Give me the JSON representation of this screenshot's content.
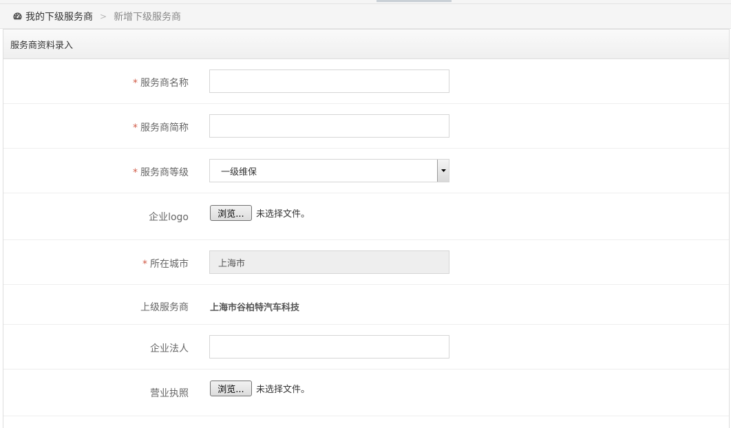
{
  "breadcrumb": {
    "home_icon": "dashboard-icon",
    "home_label": "我的下级服务商",
    "separator": ">",
    "current_label": "新增下级服务商"
  },
  "panel": {
    "title": "服务商资料录入"
  },
  "form": {
    "required_mark": "*",
    "provider_name": {
      "label": "服务商名称",
      "value": "",
      "placeholder": ""
    },
    "provider_short_name": {
      "label": "服务商简称",
      "value": "",
      "placeholder": ""
    },
    "provider_level": {
      "label": "服务商等级",
      "selected": "一级维保",
      "arrow_icon": "dropdown-arrow-icon"
    },
    "company_logo": {
      "label": "企业logo",
      "button_label": "浏览...",
      "status": "未选择文件。"
    },
    "city": {
      "label": "所在城市",
      "value": "上海市"
    },
    "parent_provider": {
      "label": "上级服务商",
      "value": "上海市谷柏特汽车科技"
    },
    "legal_person": {
      "label": "企业法人",
      "value": "",
      "placeholder": ""
    },
    "business_license": {
      "label": "营业执照",
      "button_label": "浏览...",
      "status": "未选择文件。"
    }
  },
  "colors": {
    "required": "#d15b47",
    "label": "#666666",
    "disabled_bg": "#eeeeee"
  }
}
